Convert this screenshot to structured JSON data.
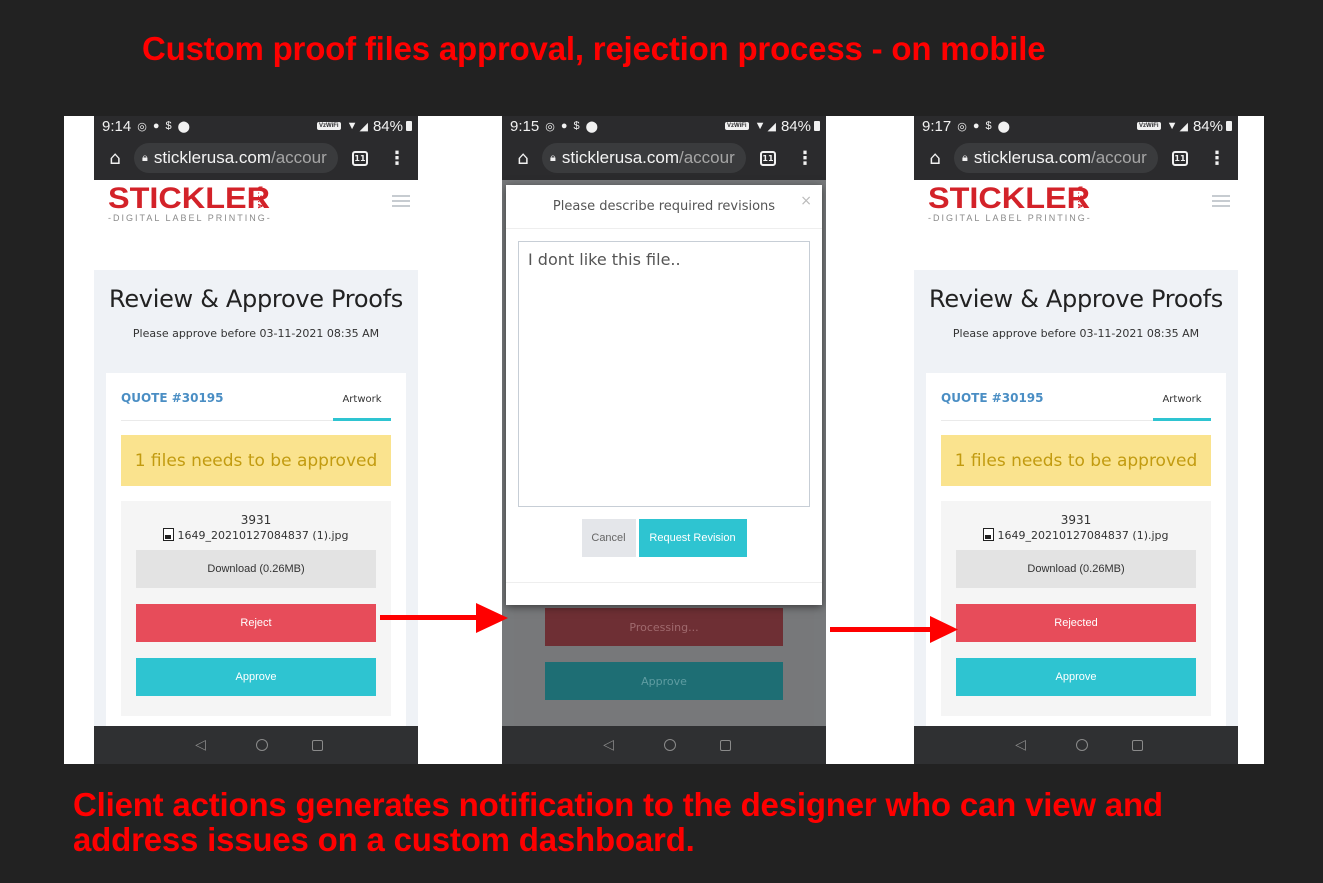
{
  "headline": "Custom proof files approval, rejection process - on mobile",
  "caption": "Client actions generates notification to the designer who can view and address issues on a custom dashboard.",
  "colors": {
    "annotation_red": "#ff0000",
    "brand_red": "#d32229",
    "reject_red": "#e74c5a",
    "approve_teal": "#2ec4d1",
    "alert_yellow": "#fae38e",
    "quote_blue": "#4a8ec4"
  },
  "browser": {
    "url_domain": "sticklerusa.com",
    "url_path": "/accour",
    "tab_count": "11",
    "battery": "84%",
    "wifi_badge": "VzWiFi"
  },
  "site": {
    "brand": "STICKLER",
    "brand_suffix": "U.S.A",
    "tagline": "-DIGITAL LABEL PRINTING-"
  },
  "screens": [
    {
      "time": "9:14",
      "title": "Review & Approve Proofs",
      "deadline": "Please approve before 03-11-2021 08:35 AM",
      "quote": "QUOTE #30195",
      "tab": "Artwork",
      "alert": "1 files needs to be approved",
      "file_id": "3931",
      "file_name": "1649_20210127084837 (1).jpg",
      "download_label": "Download (0.26MB)",
      "reject_label": "Reject",
      "approve_label": "Approve"
    },
    {
      "time": "9:15",
      "modal": {
        "title": "Please describe required revisions",
        "close": "×",
        "textarea_value": "I dont like this file..",
        "cancel_label": "Cancel",
        "submit_label": "Request Revision"
      },
      "processing_label": "Processing...",
      "approve_label": "Approve"
    },
    {
      "time": "9:17",
      "title": "Review & Approve Proofs",
      "deadline": "Please approve before 03-11-2021 08:35 AM",
      "quote": "QUOTE #30195",
      "tab": "Artwork",
      "alert": "1 files needs to be approved",
      "file_id": "3931",
      "file_name": "1649_20210127084837 (1).jpg",
      "download_label": "Download (0.26MB)",
      "reject_label": "Rejected",
      "approve_label": "Approve"
    }
  ]
}
